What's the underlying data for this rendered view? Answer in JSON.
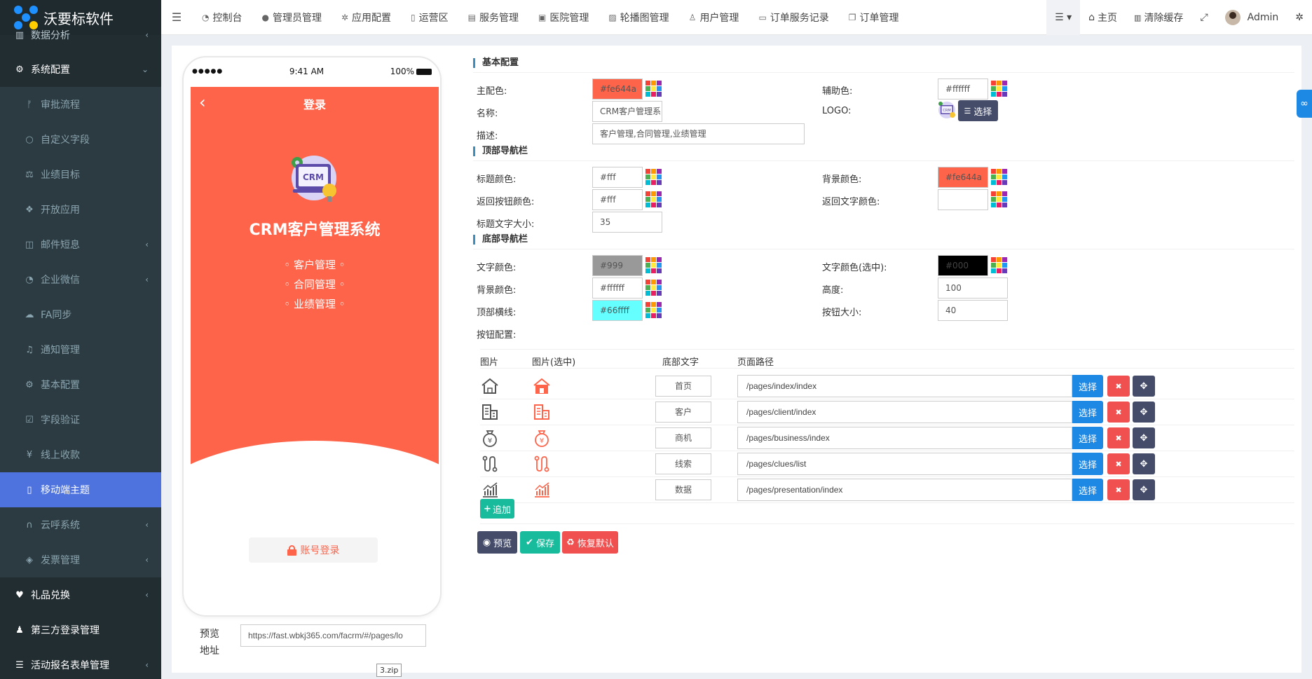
{
  "app": {
    "title": "沃要标软件"
  },
  "sidebar": {
    "items": [
      {
        "label": "数据分析",
        "icon": "chart-icon",
        "type": "top partial",
        "arrow": "‹"
      },
      {
        "label": "系统配置",
        "icon": "gears-icon",
        "type": "top open",
        "arrow": "⌄"
      },
      {
        "label": "审批流程",
        "icon": "branch-icon",
        "type": "sub",
        "arrow": ""
      },
      {
        "label": "自定义字段",
        "icon": "circle-icon",
        "type": "sub",
        "arrow": ""
      },
      {
        "label": "业绩目标",
        "icon": "scale-icon",
        "type": "sub",
        "arrow": ""
      },
      {
        "label": "开放应用",
        "icon": "cubes-icon",
        "type": "sub",
        "arrow": ""
      },
      {
        "label": "邮件短息",
        "icon": "columns-icon",
        "type": "sub",
        "arrow": "‹"
      },
      {
        "label": "企业微信",
        "icon": "wechat-icon",
        "type": "sub",
        "arrow": "‹"
      },
      {
        "label": "FA同步",
        "icon": "cloud-icon",
        "type": "sub",
        "arrow": ""
      },
      {
        "label": "通知管理",
        "icon": "bell-icon",
        "type": "sub",
        "arrow": ""
      },
      {
        "label": "基本配置",
        "icon": "gear-icon",
        "type": "sub",
        "arrow": ""
      },
      {
        "label": "字段验证",
        "icon": "check-square-icon",
        "type": "sub",
        "arrow": ""
      },
      {
        "label": "线上收款",
        "icon": "yen-icon",
        "type": "sub",
        "arrow": ""
      },
      {
        "label": "移动端主题",
        "icon": "mobile-icon",
        "type": "sub active",
        "arrow": ""
      },
      {
        "label": "云呼系统",
        "icon": "headphones-icon",
        "type": "sub",
        "arrow": "‹"
      },
      {
        "label": "发票管理",
        "icon": "tag-icon",
        "type": "sub",
        "arrow": "‹"
      },
      {
        "label": "礼品兑换",
        "icon": "heart-icon",
        "type": "top white",
        "arrow": "‹"
      },
      {
        "label": "第三方登录管理",
        "icon": "users-icon",
        "type": "top white",
        "arrow": ""
      },
      {
        "label": "活动报名表单管理",
        "icon": "list-icon",
        "type": "top white",
        "arrow": "‹"
      }
    ]
  },
  "navbar": {
    "items": [
      {
        "label": "控制台",
        "icon": "dashboard-icon",
        "glyph": "◔"
      },
      {
        "label": "管理员管理",
        "icon": "user-icon",
        "glyph": "●"
      },
      {
        "label": "应用配置",
        "icon": "gear-icon",
        "glyph": "✲"
      },
      {
        "label": "运营区",
        "icon": "map-icon",
        "glyph": "▯"
      },
      {
        "label": "服务管理",
        "icon": "list-alt-icon",
        "glyph": "▤"
      },
      {
        "label": "医院管理",
        "icon": "hospital-icon",
        "glyph": "▣"
      },
      {
        "label": "轮播图管理",
        "icon": "image-icon",
        "glyph": "▨"
      },
      {
        "label": "用户管理",
        "icon": "user-outline-icon",
        "glyph": "♙"
      },
      {
        "label": "订单服务记录",
        "icon": "save-icon",
        "glyph": "▭"
      },
      {
        "label": "订单管理",
        "icon": "copy-icon",
        "glyph": "❐"
      }
    ],
    "home": "主页",
    "clear_cache": "清除缓存",
    "admin": "Admin"
  },
  "phone": {
    "time": "9:41 AM",
    "battery": "100%",
    "signal": "●●●●●",
    "screen_title": "登录",
    "app_name": "CRM客户管理系统",
    "logo_text": "CRM",
    "features": [
      "◦ 客户管理 ◦",
      "◦ 合同管理 ◦",
      "◦ 业绩管理 ◦"
    ],
    "login_button": "账号登录"
  },
  "preview": {
    "label": "预览地址",
    "url": "https://fast.wbkj365.com/facrm/#/pages/lo",
    "file_tip": "3.zip"
  },
  "sections": {
    "basic": "基本配置",
    "top_nav": "顶部导航栏",
    "bottom_nav": "底部导航栏"
  },
  "basic": {
    "main_color": {
      "label": "主配色:",
      "value": "#fe644a"
    },
    "sub_color": {
      "label": "辅助色:",
      "value": "#ffffff"
    },
    "name": {
      "label": "名称:",
      "value": "CRM客户管理系"
    },
    "logo": {
      "label": "LOGO:",
      "button": "选择",
      "logo_text": "CRM"
    },
    "desc": {
      "label": "描述:",
      "value": "客户管理,合同管理,业绩管理"
    }
  },
  "top_nav": {
    "title_color": {
      "label": "标题颜色:",
      "value": "#fff"
    },
    "bg_color": {
      "label": "背景颜色:",
      "value": "#fe644a"
    },
    "back_color": {
      "label": "返回按钮颜色:",
      "value": "#fff"
    },
    "back_text_color": {
      "label": "返回文字颜色:",
      "value": ""
    },
    "title_size": {
      "label": "标题文字大小:",
      "value": "35"
    }
  },
  "bottom_nav": {
    "text_color": {
      "label": "文字颜色:",
      "value": "#999"
    },
    "text_color_active": {
      "label": "文字颜色(选中):",
      "value": "#000"
    },
    "bg_color": {
      "label": "背景颜色:",
      "value": "#ffffff"
    },
    "height": {
      "label": "高度:",
      "value": "100"
    },
    "top_line": {
      "label": "顶部横线:",
      "value": "#66ffff"
    },
    "btn_size": {
      "label": "按钮大小:",
      "value": "40"
    },
    "buttons_label": "按钮配置:"
  },
  "table": {
    "headers": {
      "image": "图片",
      "image_active": "图片(选中)",
      "text": "底部文字",
      "path": "页面路径"
    },
    "rows": [
      {
        "text": "首页",
        "path": "/pages/index/index",
        "icon": "home-icon"
      },
      {
        "text": "客户",
        "path": "/pages/client/index",
        "icon": "building-icon"
      },
      {
        "text": "商机",
        "path": "/pages/business/index",
        "icon": "money-bag-icon"
      },
      {
        "text": "线索",
        "path": "/pages/clues/list",
        "icon": "route-icon"
      },
      {
        "text": "数据",
        "path": "/pages/presentation/index",
        "icon": "chart-bar-icon"
      }
    ],
    "choose_label": "选择",
    "add_label": "追加"
  },
  "actions": {
    "preview": "预览",
    "save": "保存",
    "reset": "恢复默认"
  },
  "colors": {
    "accent": "#fe644a",
    "sidebar": "#222d32",
    "active": "#4e73df",
    "blue": "#1e88e5",
    "green": "#18bc9c",
    "red": "#f05050",
    "dark": "#444c69"
  }
}
